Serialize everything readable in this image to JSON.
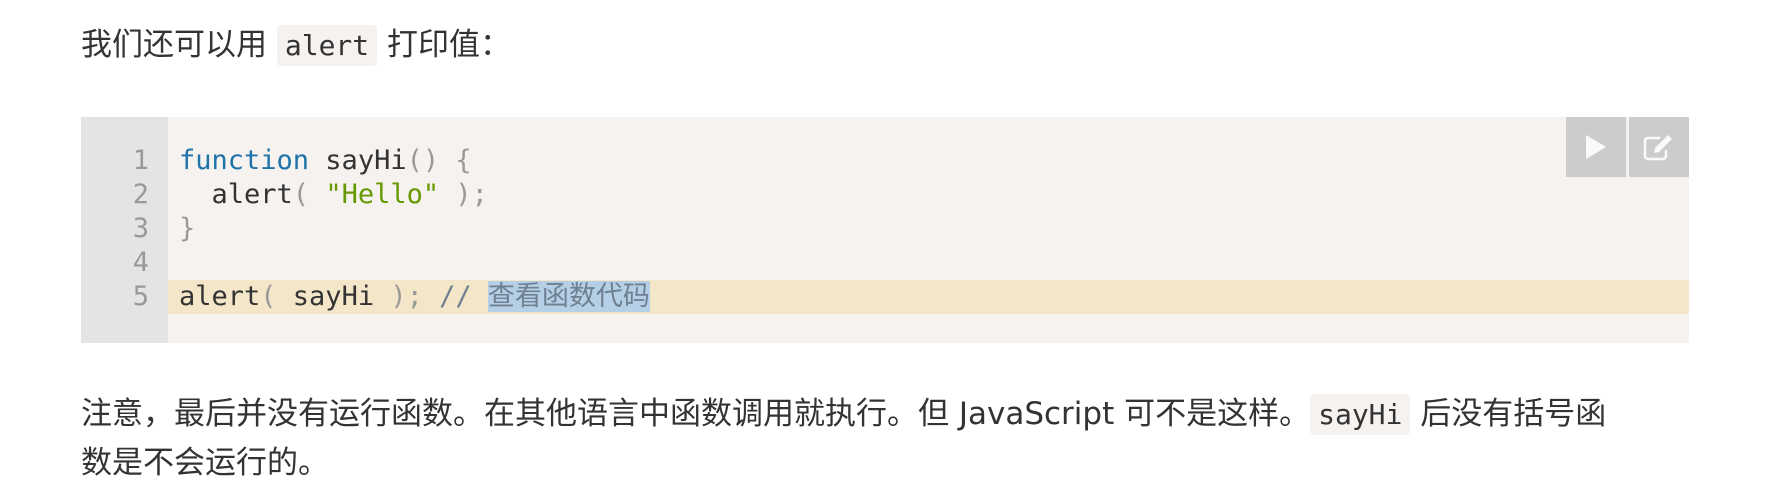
{
  "intro": {
    "before": "我们还可以用",
    "code": "alert",
    "after": "打印值："
  },
  "code_block": {
    "lines": [
      {
        "number": "1",
        "kw": "function",
        "rest": " sayHi",
        "punct": "() {"
      },
      {
        "number": "2",
        "indent": "  ",
        "fn": "alert",
        "p1": "( ",
        "str": "\"Hello\"",
        "p2": " );"
      },
      {
        "number": "3",
        "punct": "}"
      },
      {
        "number": "4"
      },
      {
        "number": "5",
        "fn": "alert",
        "p1": "( ",
        "arg": "sayHi",
        "p2": " ); ",
        "comment": "//",
        "selected": "查看函数代码"
      }
    ],
    "run_button": "run",
    "edit_button": "edit"
  },
  "note": {
    "part1": "注意，最后并没有运行函数。在其他语言中函数调用就执行。但 JavaScript 可不是这样。",
    "code": "sayHi",
    "part2": "后没有括号函",
    "line2": "数是不会运行的。"
  }
}
